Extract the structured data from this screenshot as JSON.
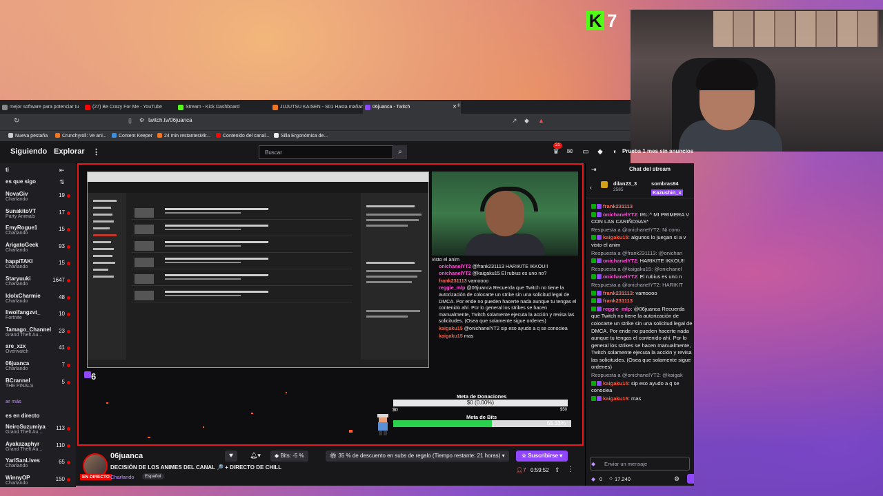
{
  "overlay": {
    "kick_count": "7"
  },
  "browser": {
    "tabs": [
      {
        "label": "mejor software para potenciar tu"
      },
      {
        "label": "(27) Be Crazy For Me - YouTube"
      },
      {
        "label": "Stream - Kick Dashboard"
      },
      {
        "label": "JUJUTSU KAISEN - S01 Hasta mañana"
      },
      {
        "label": "06juanca - Twitch"
      }
    ],
    "url": "twitch.tv/06juanca",
    "bookmarks": [
      "Nueva pestaña",
      "Crunchyroll: Ve ani...",
      "Content Keeper",
      "24 min restantesMir...",
      "Contenido del canal...",
      "Silla Ergonómica de..."
    ]
  },
  "twitch": {
    "nav": {
      "following": "Siguiendo",
      "browse": "Explorar",
      "search_placeholder": "Buscar",
      "promo": "Prueba 1 mes sin anuncios",
      "notif_count": "21"
    },
    "sidebar": {
      "title": "es que sigo",
      "channels": [
        {
          "name": "NovaGiv",
          "game": "Charlando",
          "viewers": "19"
        },
        {
          "name": "SunakitoVT",
          "game": "Party Animals",
          "viewers": "17"
        },
        {
          "name": "EmyRogue1",
          "game": "Charlando",
          "viewers": "15"
        },
        {
          "name": "ArigatoGeek",
          "game": "Charlando",
          "viewers": "93"
        },
        {
          "name": "happiTAKI",
          "game": "Charlando",
          "viewers": "15"
        },
        {
          "name": "Staryuuki",
          "game": "Charlando",
          "viewers": "1647"
        },
        {
          "name": "IdolxCharmie",
          "game": "Charlando",
          "viewers": "48"
        },
        {
          "name": "liwolfangzvt_",
          "game": "Fortnite",
          "viewers": "10"
        },
        {
          "name": "Tamago_Channel",
          "game": "Grand Theft Au...",
          "viewers": "23"
        },
        {
          "name": "are_xzx",
          "game": "Overwatch",
          "viewers": "41"
        },
        {
          "name": "06juanca",
          "game": "Charlando",
          "viewers": "7"
        },
        {
          "name": "BCrannel",
          "game": "THE FINALS",
          "viewers": "5"
        }
      ],
      "show_more": "ar más",
      "live_title": "es en directo",
      "live_channels": [
        {
          "name": "NeiroSuzumiya",
          "game": "Grand Theft Au...",
          "viewers": "113"
        },
        {
          "name": "Ayakazaphyr",
          "game": "Grand Theft Au...",
          "viewers": "110"
        },
        {
          "name": "YariSanLives",
          "game": "Charlando",
          "viewers": "65"
        },
        {
          "name": "WinnyOP",
          "game": "Charlando",
          "viewers": "150"
        }
      ]
    },
    "player": {
      "stream_number": "6",
      "overlay_chat": [
        {
          "user": "",
          "text": "visto el anim"
        },
        {
          "user": "onichanelYT2",
          "text": "@frank231113 HARIKITE IKKOU!!"
        },
        {
          "user": "onichanelYT2",
          "text": "@kaigaku15 El rubius es uno no?"
        },
        {
          "user": "frank231113",
          "text": "vamoooo"
        },
        {
          "user": "reggie_mlp",
          "text": "@06juanca Recuerda que Twitch no tiene la autorización de colocarte un strike sin una solicitud legal de DMCA. Por ende no pueden hacerte nada aunque tu tengas el contenido ahí. Por lo general los strikes se hacen manualmente, Twitch solamente ejecuta la acción y revisa las solicitudes. (Osea que solamente sigue ordenes)"
        },
        {
          "user": "kaigaku15",
          "text": "@onichanelYT2 sip eso ayudo a q se conocieа"
        },
        {
          "user": "kaigaku15",
          "text": "mas"
        }
      ],
      "donation": {
        "title": "Meta de Donaciones",
        "value": "$0 (0.00%)",
        "min": "$0",
        "max": "$50",
        "fraction": 0.0
      },
      "bits": {
        "title": "Meta de Bits",
        "value": "55.33%",
        "fraction": 0.5533
      }
    },
    "channel": {
      "name": "06juanca",
      "live": "EN DIRECTO",
      "title": "DECISIÓN DE LOS ANIMES DEL CANAL 🔎 + DIRECTO DE CHILL",
      "category": "Charlando",
      "language": "Español",
      "bits_label": "Bits: -5 %",
      "gift_label": "35 % de descuento en subs de regalo (Tiempo restante: 21 horas)",
      "subscribe": "Suscribirse",
      "viewers": "7",
      "uptime": "0:59:52"
    },
    "chat": {
      "title": "Chat del stream",
      "top_users": [
        "dilan23_3",
        "sombras94",
        "Kazushin_x"
      ],
      "top_count": "2585",
      "messages": [
        {
          "reply": "",
          "user": "frank231113",
          "color": "#ff6b5c",
          "text": ""
        },
        {
          "reply": "",
          "user": "onichanelYT2",
          "color": "#ff4fd8",
          "text": "IRL:^ MI PRIMERA V CON LAS CARIÑOSAS*"
        },
        {
          "reply": "Respuesta a @onichanelYT2: Ni cono",
          "user": "kaigaku15",
          "color": "#ff5a3c",
          "text": "algunos lo juegan si a v visto el anim"
        },
        {
          "reply": "Respuesta a @frank231113: @onichan",
          "user": "onichanelYT2",
          "color": "#ff4fd8",
          "text": "HARIKITE IKKOU!!"
        },
        {
          "reply": "Respuesta a @kaigaku15: @onichanel",
          "user": "onichanelYT2",
          "color": "#ff4fd8",
          "text": "El rubius es uno n"
        },
        {
          "reply": "Respuesta a @onichanelYT2: HARIKIT",
          "user": "frank231113",
          "color": "#ff6b5c",
          "text": "vamoooo"
        },
        {
          "reply": "",
          "user": "frank231113",
          "color": "#ff6b5c",
          "text": ""
        },
        {
          "reply": "",
          "user": "reggie_mlp",
          "color": "#ff4fd8",
          "text": "@06juanca Recuerda que Twitch no tiene la autorización de colocarte un strike sin una solicitud legal de DMCA. Por ende no pueden hacerte nada aunque tu tengas el contenido ahí. Por lo general los strikes se hacen manualmente, Twitch solamente ejecuta la acción y revisa las solicitudes. (Osea que solamente sigue ordenes)"
        },
        {
          "reply": "Respuesta a @onichanelYT2: @kaigak",
          "user": "kaigaku15",
          "color": "#ff5a3c",
          "text": "sip eso ayudo a q se conocieа"
        },
        {
          "reply": "",
          "user": "kaigaku15",
          "color": "#ff5a3c",
          "text": "mas"
        }
      ],
      "input_placeholder": "Enviar un mensaje",
      "points_a": "0",
      "points_b": "17.240"
    }
  }
}
